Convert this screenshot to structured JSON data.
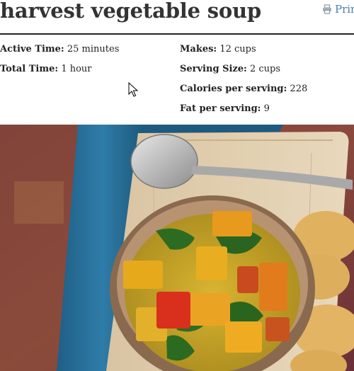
{
  "recipe": {
    "title": "harvest vegetable soup",
    "print_label": "Prin",
    "print_icon": "printer-icon"
  },
  "details": {
    "left": [
      {
        "label": "Active Time:",
        "value": " 25 minutes"
      },
      {
        "label": "Total Time:",
        "value": " 1 hour"
      }
    ],
    "right": [
      {
        "label": "Makes:",
        "value": " 12 cups"
      },
      {
        "label": "Serving Size:",
        "value": " 2 cups"
      },
      {
        "label": "Calories per serving:",
        "value": " 228"
      },
      {
        "label": "Fat per serving:",
        "value": " 9"
      }
    ]
  },
  "colors": {
    "link": "#4a7fb0",
    "text": "#333333",
    "rule": "#222222"
  }
}
